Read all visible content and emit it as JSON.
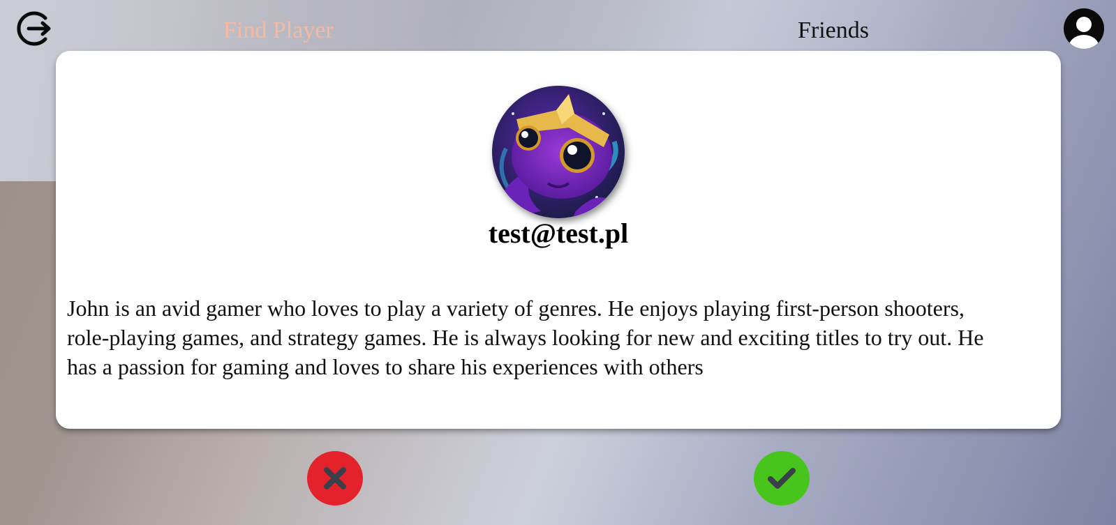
{
  "nav": {
    "logout_icon": "logout-icon",
    "find_player_label": "Find Player",
    "friends_label": "Friends",
    "profile_icon": "user-profile-icon"
  },
  "player": {
    "avatar_icon": "octopus-avatar-image",
    "username": "test@test.pl",
    "bio": "John is an avid gamer who loves to play a variety of genres. He enjoys playing first-person shooters, role-playing games, and strategy games. He is always looking for new and exciting titles to try out. He has a passion for gaming and loves to share his experiences with others"
  },
  "actions": {
    "reject_icon": "close-icon",
    "accept_icon": "checkmark-icon"
  },
  "colors": {
    "active_nav": "#f7b9a0",
    "reject": "#e4222b",
    "accept": "#47c51c",
    "action_icon": "#3b3f4a"
  }
}
